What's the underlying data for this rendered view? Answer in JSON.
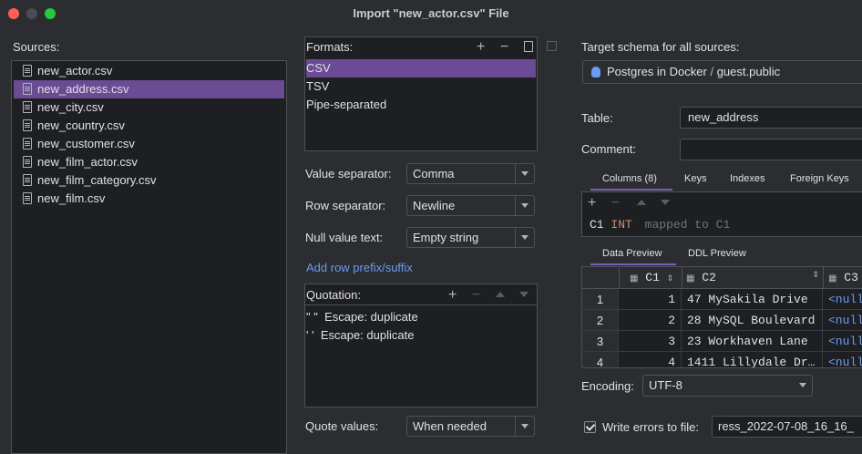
{
  "window": {
    "title": "Import \"new_actor.csv\" File"
  },
  "sources": {
    "label": "Sources:",
    "items": [
      "new_actor.csv",
      "new_address.csv",
      "new_city.csv",
      "new_country.csv",
      "new_customer.csv",
      "new_film_actor.csv",
      "new_film_category.csv",
      "new_film.csv"
    ],
    "selected_index": 1
  },
  "formats": {
    "label": "Formats:",
    "items": [
      "CSV",
      "TSV",
      "Pipe-separated"
    ],
    "selected_index": 0
  },
  "options": {
    "value_separator": {
      "label": "Value separator:",
      "value": "Comma"
    },
    "row_separator": {
      "label": "Row separator:",
      "value": "Newline"
    },
    "null_value": {
      "label": "Null value text:",
      "value": "Empty string"
    },
    "add_row_link": "Add row prefix/suffix",
    "quotation_label": "Quotation:",
    "quotation_rows": [
      {
        "quote": "\" \"",
        "escape": "Escape: duplicate"
      },
      {
        "quote": "' '",
        "escape": "Escape: duplicate"
      }
    ],
    "quote_values": {
      "label": "Quote values:",
      "value": "When needed"
    }
  },
  "target": {
    "schema_label": "Target schema for all sources:",
    "datasource": "Postgres in Docker",
    "separator": "/",
    "schema": "guest.public",
    "table_label": "Table:",
    "table_value": "new_address",
    "comment_label": "Comment:",
    "comment_value": ""
  },
  "table_tabs": [
    "Columns (8)",
    "Keys",
    "Indexes",
    "Foreign Keys"
  ],
  "column_row": {
    "name": "C1",
    "type": "INT",
    "hint": "mapped to C1"
  },
  "preview_tabs": [
    "Data Preview",
    "DDL Preview"
  ],
  "preview": {
    "headers": [
      "C1",
      "C2",
      "C3"
    ],
    "rows": [
      {
        "num": "1",
        "c1": "1",
        "c2": "47 MySakila Drive",
        "c3": "<null"
      },
      {
        "num": "2",
        "c1": "2",
        "c2": "28 MySQL Boulevard",
        "c3": "<null"
      },
      {
        "num": "3",
        "c1": "3",
        "c2": "23 Workhaven Lane",
        "c3": "<null"
      },
      {
        "num": "4",
        "c1": "4",
        "c2": "1411 Lillydale Dr…",
        "c3": "<null"
      }
    ]
  },
  "encoding": {
    "label": "Encoding:",
    "value": "UTF-8"
  },
  "write_errors": {
    "label": "Write errors to file:",
    "value": "ress_2022-07-08_16_16_"
  },
  "colors": {
    "selection": "#6a4b94",
    "link": "#6b9bf2",
    "accent_tab": "#7a5fb5",
    "close": "#ff5f57",
    "minimize": "#4a4c50",
    "maximize": "#28c840"
  }
}
